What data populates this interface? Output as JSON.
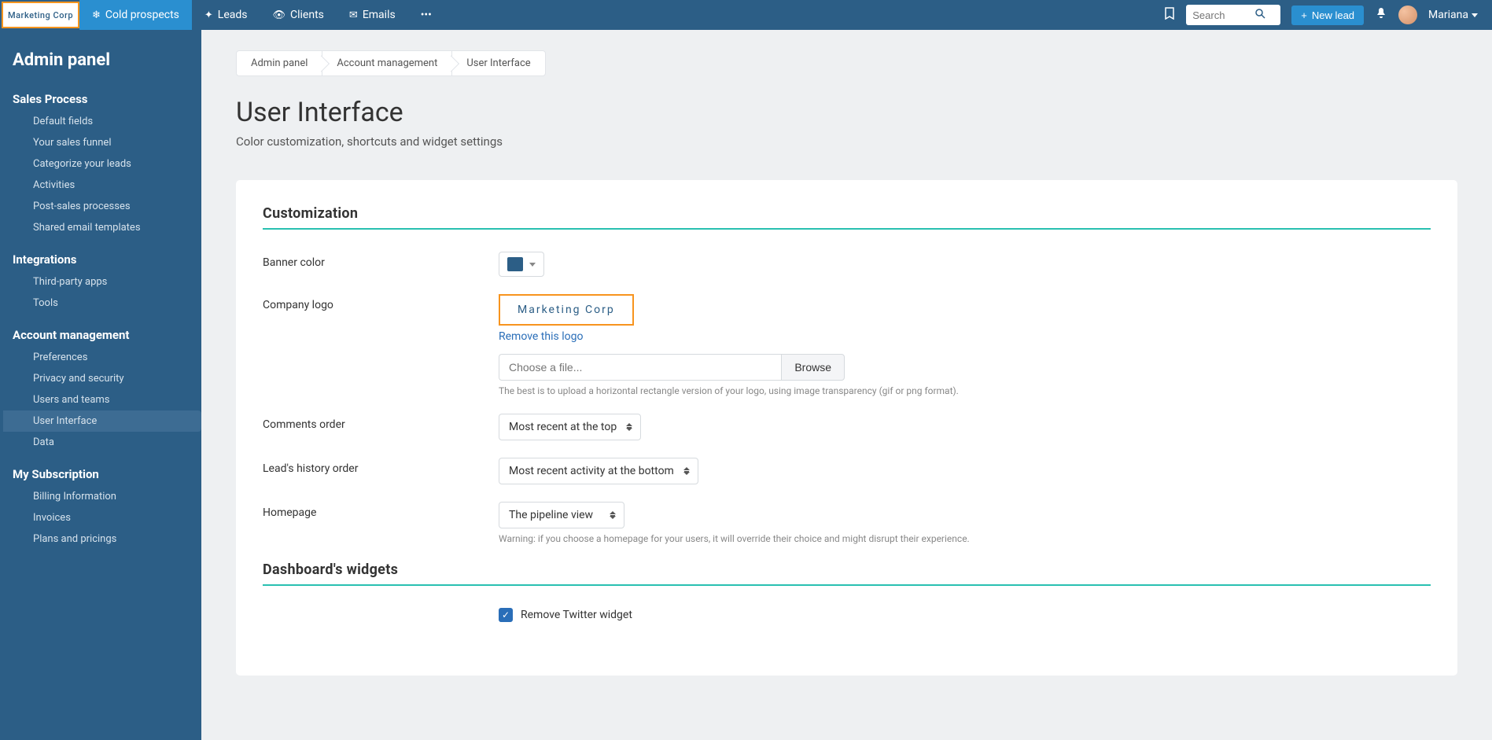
{
  "brand": {
    "name": "Marketing Corp"
  },
  "topnav": {
    "tabs": [
      {
        "label": "Cold prospects",
        "icon": "❄",
        "active": true
      },
      {
        "label": "Leads",
        "icon": "✦",
        "active": false
      },
      {
        "label": "Clients",
        "icon": "👁",
        "active": false
      },
      {
        "label": "Emails",
        "icon": "✉",
        "active": false
      }
    ],
    "search_placeholder": "Search",
    "new_lead_label": "New lead",
    "user_name": "Mariana"
  },
  "sidebar": {
    "title": "Admin panel",
    "sections": [
      {
        "title": "Sales Process",
        "items": [
          {
            "label": "Default fields"
          },
          {
            "label": "Your sales funnel"
          },
          {
            "label": "Categorize your leads"
          },
          {
            "label": "Activities"
          },
          {
            "label": "Post-sales processes"
          },
          {
            "label": "Shared email templates"
          }
        ]
      },
      {
        "title": "Integrations",
        "items": [
          {
            "label": "Third-party apps"
          },
          {
            "label": "Tools"
          }
        ]
      },
      {
        "title": "Account management",
        "items": [
          {
            "label": "Preferences"
          },
          {
            "label": "Privacy and security"
          },
          {
            "label": "Users and teams"
          },
          {
            "label": "User Interface",
            "active": true
          },
          {
            "label": "Data"
          }
        ]
      },
      {
        "title": "My Subscription",
        "items": [
          {
            "label": "Billing Information"
          },
          {
            "label": "Invoices"
          },
          {
            "label": "Plans and pricings"
          }
        ]
      }
    ]
  },
  "breadcrumb": [
    {
      "label": "Admin panel"
    },
    {
      "label": "Account management"
    },
    {
      "label": "User Interface"
    }
  ],
  "page": {
    "title": "User Interface",
    "subtitle": "Color customization, shortcuts and widget settings"
  },
  "customization": {
    "heading": "Customization",
    "banner_color": {
      "label": "Banner color",
      "value": "#2c5e86"
    },
    "company_logo": {
      "label": "Company logo",
      "preview_text": "Marketing Corp",
      "remove_label": "Remove this logo",
      "file_placeholder": "Choose a file...",
      "browse_label": "Browse",
      "help": "The best is to upload a horizontal rectangle version of your logo, using image transparency (gif or png format)."
    },
    "comments_order": {
      "label": "Comments order",
      "value": "Most recent at the top"
    },
    "history_order": {
      "label": "Lead's history order",
      "value": "Most recent activity at the bottom"
    },
    "homepage": {
      "label": "Homepage",
      "value": "The pipeline view",
      "warning": "Warning: if you choose a homepage for your users, it will override their choice and might disrupt their experience."
    }
  },
  "widgets": {
    "heading": "Dashboard's widgets",
    "remove_twitter": {
      "label": "Remove Twitter widget",
      "checked": true
    }
  }
}
